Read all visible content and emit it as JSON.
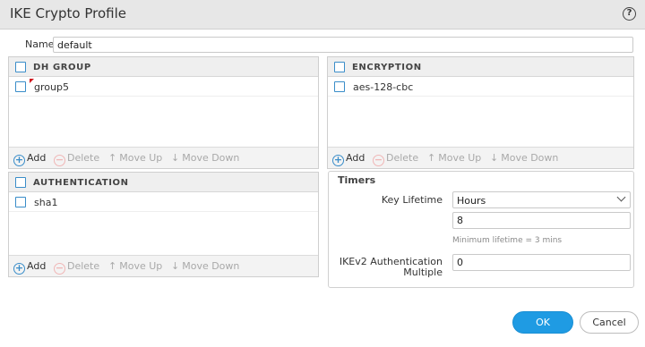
{
  "dialog": {
    "title": "IKE Crypto Profile",
    "help_glyph": "?"
  },
  "name": {
    "label": "Name",
    "value": "default"
  },
  "dh_group": {
    "header": "DH GROUP",
    "rows": [
      "group5"
    ]
  },
  "encryption": {
    "header": "ENCRYPTION",
    "rows": [
      "aes-128-cbc"
    ]
  },
  "authentication": {
    "header": "AUTHENTICATION",
    "rows": [
      "sha1"
    ]
  },
  "toolbar": {
    "add_label": "Add",
    "delete_label": "Delete",
    "move_up_label": "Move Up",
    "move_down_label": "Move Down",
    "add_glyph": "+",
    "delete_glyph": "−",
    "up_glyph": "↑",
    "down_glyph": "↓"
  },
  "timers": {
    "title": "Timers",
    "key_lifetime_label": "Key Lifetime",
    "key_lifetime_unit": "Hours",
    "key_lifetime_value": "8",
    "min_lifetime_hint": "Minimum lifetime = 3 mins",
    "ikev2_label_line1": "IKEv2 Authentication",
    "ikev2_label_line2": "Multiple",
    "ikev2_value": "0"
  },
  "footer": {
    "ok_label": "OK",
    "cancel_label": "Cancel"
  },
  "colors": {
    "accent": "#1f9be3",
    "checkbox": "#3a8dc9",
    "flag": "#d0141c"
  }
}
